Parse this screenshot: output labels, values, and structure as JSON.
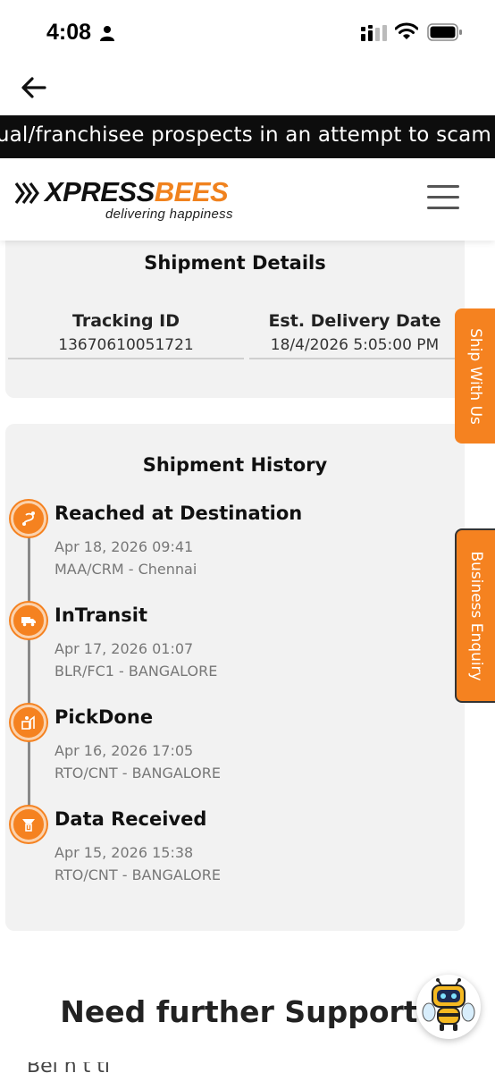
{
  "status_bar": {
    "time": "4:08",
    "icons": [
      "person-icon",
      "cellular-signal-icon",
      "wifi-icon",
      "battery-icon"
    ]
  },
  "navigation": {
    "back_icon": "arrow-left-icon"
  },
  "ticker": {
    "text": "lual/franchisee prospects in an attempt to scam"
  },
  "header": {
    "logo_word_1": "XPRESS",
    "logo_word_2": "BEES",
    "logo_tagline": "delivering happiness",
    "menu_icon": "hamburger-menu-icon"
  },
  "shipment_details": {
    "title": "Shipment Details",
    "tracking_id_label": "Tracking ID",
    "tracking_id_value": "13670610051721",
    "delivery_label": "Est. Delivery Date",
    "delivery_value": "18/4/2026 5:05:00 PM"
  },
  "shipment_history": {
    "title": "Shipment History",
    "events": [
      {
        "status": "Reached at Destination",
        "time": "Apr 18, 2026 09:41",
        "location": "MAA/CRM - Chennai",
        "icon": "route-icon"
      },
      {
        "status": "InTransit",
        "time": "Apr 17, 2026 01:07",
        "location": "BLR/FC1 - BANGALORE",
        "icon": "truck-icon"
      },
      {
        "status": "PickDone",
        "time": "Apr 16, 2026 17:05",
        "location": "RTO/CNT - BANGALORE",
        "icon": "package-pickup-icon"
      },
      {
        "status": "Data Received",
        "time": "Apr 15, 2026 15:38",
        "location": "RTO/CNT - BANGALORE",
        "icon": "data-received-icon"
      }
    ]
  },
  "side_tabs": {
    "ship_with_us": "Ship With Us",
    "business_enquiry": "Business Enquiry"
  },
  "support": {
    "title": "Need further Support?",
    "body_partial": "Bei                                   h                 t ti"
  },
  "colors": {
    "brand_orange": "#f58220",
    "ticker_bg": "#0d0d0d",
    "card_bg": "#f2f2f2"
  }
}
